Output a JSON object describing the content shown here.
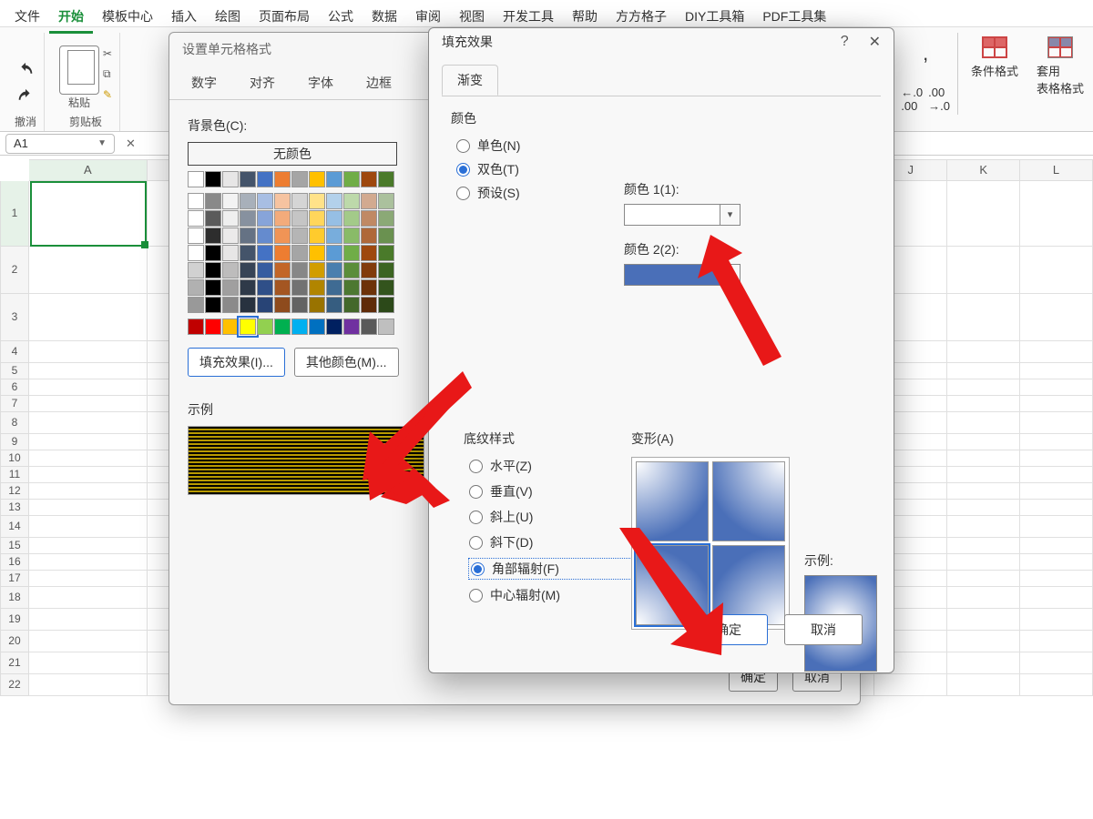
{
  "menu": {
    "items": [
      "文件",
      "开始",
      "模板中心",
      "插入",
      "绘图",
      "页面布局",
      "公式",
      "数据",
      "审阅",
      "视图",
      "开发工具",
      "帮助",
      "方方格子",
      "DIY工具箱",
      "PDF工具集"
    ],
    "active": 1
  },
  "ribbon": {
    "undo": "撤消",
    "clipboard": "剪贴板",
    "paste": "粘贴",
    "condfmt_label": "条件格式",
    "tabfmt_label": "套用\n表格格式"
  },
  "namebox": "A1",
  "dialog1": {
    "title": "设置单元格格式",
    "tabs": [
      "数字",
      "对齐",
      "字体",
      "边框"
    ],
    "bgcolor_label": "背景色(C):",
    "nocolor": "无颜色",
    "fill_effect_btn": "填充效果(I)...",
    "other_color_btn": "其他颜色(M)...",
    "example_label": "示例",
    "ok": "确定",
    "cancel": "取消"
  },
  "dialog2": {
    "title": "填充效果",
    "help": "?",
    "close": "✕",
    "tab": "渐变",
    "color_section": "颜色",
    "radios_color": [
      "单色(N)",
      "双色(T)",
      "预设(S)"
    ],
    "color_selected": 1,
    "color1_label": "颜色 1(1):",
    "color2_label": "颜色 2(2):",
    "color2_hex": "#4a6fb8",
    "shading_section": "底纹样式",
    "radios_shading": [
      "水平(Z)",
      "垂直(V)",
      "斜上(U)",
      "斜下(D)",
      "角部辐射(F)",
      "中心辐射(M)"
    ],
    "shading_selected": 4,
    "variants_label": "变形(A)",
    "sample_label": "示例:",
    "ok": "确定",
    "cancel": "取消"
  },
  "palette_row1": [
    "#ffffff",
    "#000000",
    "#e7e6e6",
    "#44546a",
    "#4472c4",
    "#ed7d31",
    "#a5a5a5",
    "#ffc000",
    "#5b9bd5",
    "#70ad47",
    "#9e480e",
    "#4a7a2a"
  ],
  "palette_std": [
    "#c00000",
    "#ff0000",
    "#ffc000",
    "#ffff00",
    "#92d050",
    "#00b050",
    "#00b0f0",
    "#0070c0",
    "#002060",
    "#7030a0",
    "#595959",
    "#bfbfbf"
  ],
  "columns_right": [
    "J",
    "K",
    "L"
  ],
  "col_A": "A"
}
